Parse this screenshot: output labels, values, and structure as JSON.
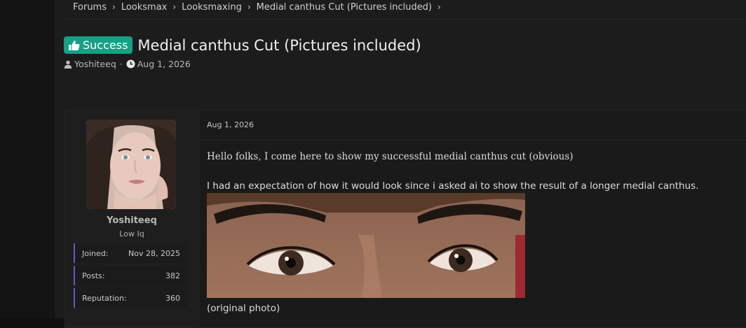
{
  "breadcrumb": {
    "items": [
      "Forums",
      "Looksmax",
      "Looksmaxing",
      "Medial canthus Cut (Pictures included)"
    ]
  },
  "thread": {
    "badge": "Success",
    "title": "Medial canthus Cut (Pictures included)",
    "author": "Yoshiteeq",
    "date": "Aug 1, 2026"
  },
  "user": {
    "name": "Yoshiteeq",
    "title": "Low Iq",
    "stats": {
      "joined_label": "Joined:",
      "joined_value": "Nov 28, 2025",
      "posts_label": "Posts:",
      "posts_value": "382",
      "rep_label": "Reputation:",
      "rep_value": "360"
    }
  },
  "post": {
    "date": "Aug 1, 2026",
    "paragraph1": "Hello folks, I come here to show my successful medial canthus cut (obvious)",
    "paragraph2": "I had an expectation of how it would look since i asked ai to show the result of a longer medial canthus.",
    "caption": "(original photo)"
  },
  "colors": {
    "badge": "#16a085",
    "stat_accent": "#5b5ec2",
    "page_bg": "#1c1c1c"
  },
  "icons": [
    "chevron-right-icon",
    "thumbs-up-icon",
    "user-icon",
    "clock-icon"
  ]
}
